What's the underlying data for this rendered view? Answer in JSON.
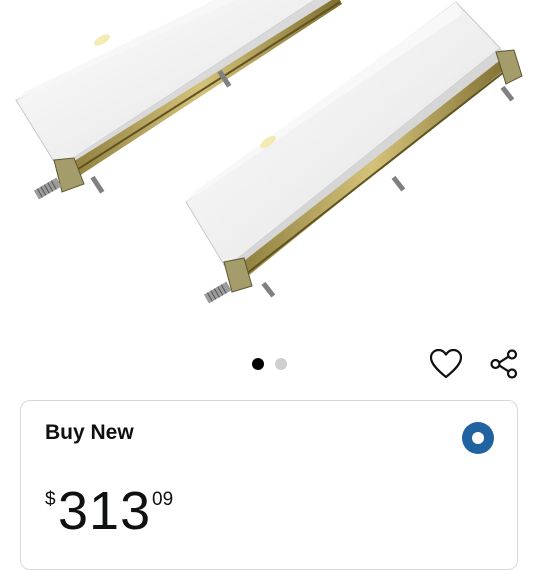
{
  "product": {
    "image": {
      "icon": "two-white-metal-rails-photo"
    },
    "carousel": {
      "count": 2,
      "active_index": 0
    }
  },
  "actions": {
    "wishlist_icon": "heart-outline-icon",
    "share_icon": "share-icon"
  },
  "buy_box": {
    "title": "Buy New",
    "selected": true,
    "price": {
      "symbol": "$",
      "whole": "313",
      "fraction": "09"
    },
    "colors": {
      "accent": "#2162a1",
      "text": "#0f1111",
      "border": "#d5d9d9"
    }
  }
}
